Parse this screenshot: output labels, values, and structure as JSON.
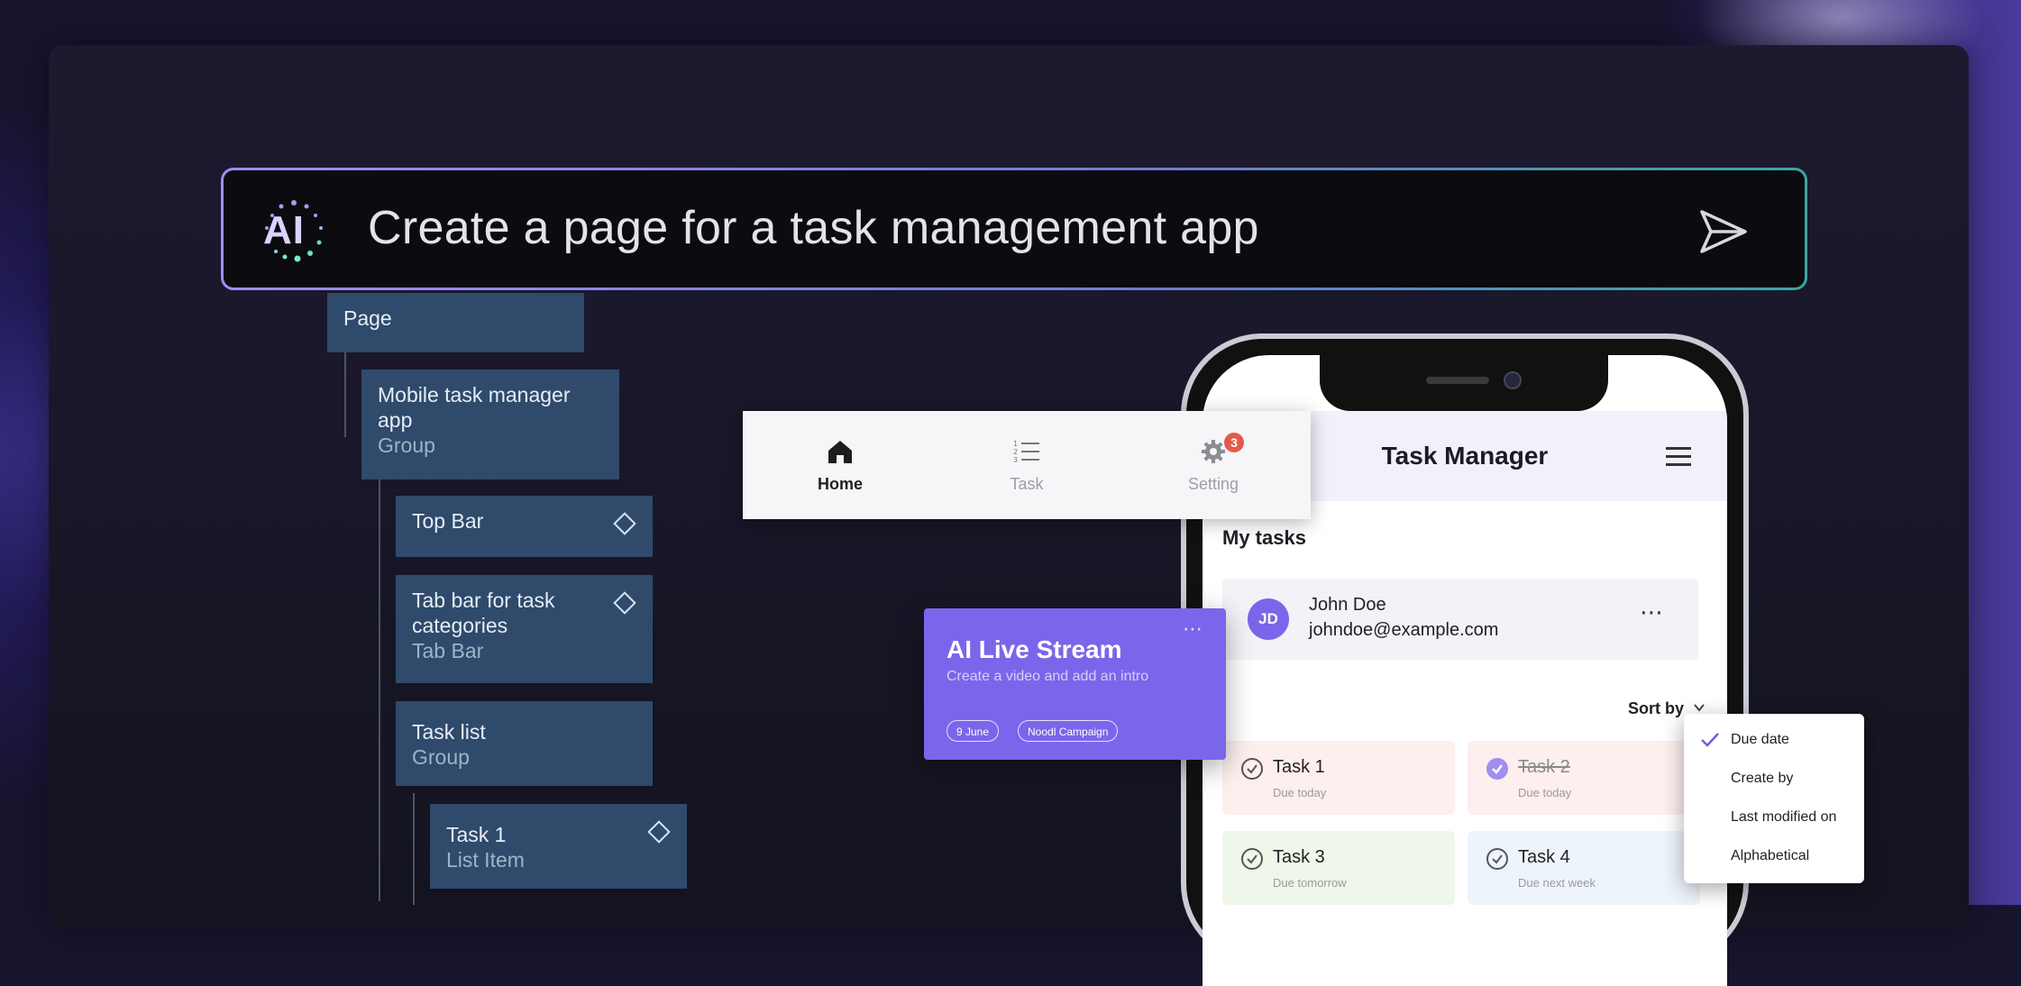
{
  "prompt": {
    "logo_text": "AI",
    "text": "Create a page for a task management app"
  },
  "tree": {
    "page": "Page",
    "group": {
      "title": "Mobile task manager app",
      "type": "Group"
    },
    "top_bar": {
      "title": "Top Bar"
    },
    "tab_bar": {
      "title": "Tab bar for task categories",
      "type": "Tab Bar"
    },
    "task_list": {
      "title": "Task list",
      "type": "Group"
    },
    "task1": {
      "title": "Task 1",
      "type": "List Item"
    }
  },
  "tabbar": {
    "tabs": [
      {
        "label": "Home",
        "icon": "home-icon"
      },
      {
        "label": "Task",
        "icon": "list-icon"
      },
      {
        "label": "Setting",
        "icon": "gear-icon",
        "badge": "3"
      }
    ]
  },
  "live_card": {
    "title": "AI Live Stream",
    "description": "Create a video and add an intro",
    "chips": [
      "9 June",
      "Noodl Campaign"
    ],
    "menu": "⋯"
  },
  "app": {
    "title": "Task Manager",
    "section": "My tasks",
    "user": {
      "initials": "JD",
      "name": "John Doe",
      "email": "johndoe@example.com"
    },
    "sort_label": "Sort by",
    "tasks": [
      {
        "name": "Task 1",
        "due": "Due today"
      },
      {
        "name": "Task 2",
        "due": "Due today"
      },
      {
        "name": "Task 3",
        "due": "Due tomorrow"
      },
      {
        "name": "Task 4",
        "due": "Due next week"
      }
    ]
  },
  "sort_menu": {
    "items": [
      "Due date",
      "Create by",
      "Last modified on",
      "Alphabetical"
    ],
    "selected": "Due date"
  },
  "colors": {
    "accent": "#7a66ea",
    "tree_node": "#2f4a6b",
    "badge": "#e25b4a"
  }
}
